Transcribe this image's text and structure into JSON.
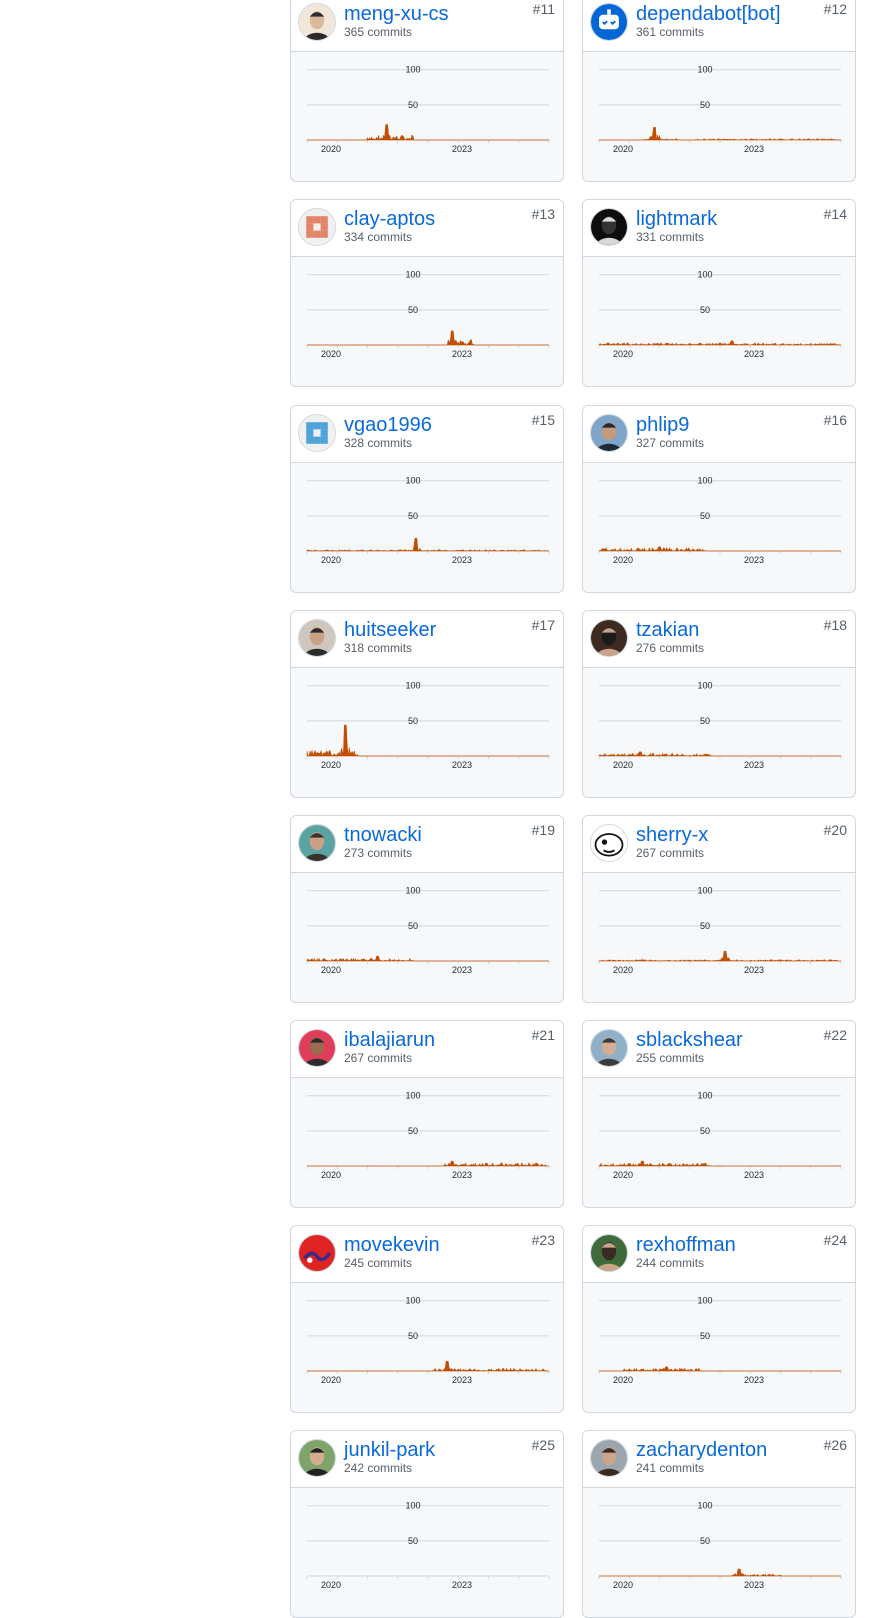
{
  "contributors": [
    {
      "rank": "#11",
      "login": "meng-xu-cs",
      "commits": "365 commits",
      "avatar_icon": "person-photo-avatar",
      "avatar_colors": [
        "#f2e6da",
        "#2b2b2b",
        "#d9b99a"
      ],
      "activity": {
        "ranges": [
          [
            0.25,
            0.44
          ]
        ],
        "peaks": [
          [
            0.33,
            22
          ]
        ],
        "level": 7
      }
    },
    {
      "rank": "#12",
      "login": "dependabot[bot]",
      "commits": "361 commits",
      "avatar_icon": "robot-avatar",
      "avatar_colors": [
        "#0366d6",
        "#ffffff",
        "#0366d6"
      ],
      "activity": {
        "ranges": [
          [
            0.18,
            0.33
          ],
          [
            0.4,
            0.99
          ]
        ],
        "peaks": [
          [
            0.23,
            18
          ]
        ],
        "level": 2
      }
    },
    {
      "rank": "#13",
      "login": "clay-aptos",
      "commits": "334 commits",
      "avatar_icon": "identicon-avatar",
      "avatar_colors": [
        "#f0f0f0",
        "#e2856b",
        "#ffffff"
      ],
      "activity": {
        "ranges": [
          [
            0.59,
            0.69
          ]
        ],
        "peaks": [
          [
            0.6,
            20
          ]
        ],
        "level": 8
      }
    },
    {
      "rank": "#14",
      "login": "lightmark",
      "commits": "331 commits",
      "avatar_icon": "person-photo-avatar",
      "avatar_colors": [
        "#0d0d0d",
        "#d8d8d8",
        "#333333"
      ],
      "activity": {
        "ranges": [
          [
            0.0,
            0.99
          ]
        ],
        "peaks": [
          [
            0.55,
            6
          ]
        ],
        "level": 3
      }
    },
    {
      "rank": "#15",
      "login": "vgao1996",
      "commits": "328 commits",
      "avatar_icon": "identicon-avatar",
      "avatar_colors": [
        "#f0f0f0",
        "#4fa3d9",
        "#ffffff"
      ],
      "activity": {
        "ranges": [
          [
            0.0,
            0.99
          ]
        ],
        "peaks": [
          [
            0.45,
            18
          ]
        ],
        "level": 2
      }
    },
    {
      "rank": "#16",
      "login": "phlip9",
      "commits": "327 commits",
      "avatar_icon": "person-photo-avatar",
      "avatar_colors": [
        "#7fa6c8",
        "#1e2a36",
        "#c49a7a"
      ],
      "activity": {
        "ranges": [
          [
            0.0,
            0.44
          ]
        ],
        "peaks": [
          [
            0.25,
            6
          ]
        ],
        "level": 5
      }
    },
    {
      "rank": "#17",
      "login": "huitseeker",
      "commits": "318 commits",
      "avatar_icon": "person-photo-avatar",
      "avatar_colors": [
        "#cfc7bd",
        "#2a2a2a",
        "#c7a184"
      ],
      "activity": {
        "ranges": [
          [
            0.0,
            0.22
          ]
        ],
        "peaks": [
          [
            0.16,
            44
          ]
        ],
        "level": 8
      }
    },
    {
      "rank": "#18",
      "login": "tzakian",
      "commits": "276 commits",
      "avatar_icon": "person-photo-avatar",
      "avatar_colors": [
        "#3d2b22",
        "#caa38a",
        "#1a1a1a"
      ],
      "activity": {
        "ranges": [
          [
            0.0,
            0.46
          ]
        ],
        "peaks": [
          [
            0.17,
            6
          ]
        ],
        "level": 4
      }
    },
    {
      "rank": "#19",
      "login": "tnowacki",
      "commits": "273 commits",
      "avatar_icon": "person-photo-avatar",
      "avatar_colors": [
        "#5aa3a0",
        "#3a3128",
        "#caa186"
      ],
      "activity": {
        "ranges": [
          [
            0.0,
            0.44
          ]
        ],
        "peaks": [
          [
            0.29,
            7
          ]
        ],
        "level": 4
      }
    },
    {
      "rank": "#20",
      "login": "sherry-x",
      "commits": "267 commits",
      "avatar_icon": "cartoon-avatar",
      "avatar_colors": [
        "#ffffff",
        "#111111",
        "#f2c14e"
      ],
      "activity": {
        "ranges": [
          [
            0.0,
            0.99
          ]
        ],
        "peaks": [
          [
            0.52,
            14
          ]
        ],
        "level": 2
      }
    },
    {
      "rank": "#21",
      "login": "ibalajiarun",
      "commits": "267 commits",
      "avatar_icon": "person-photo-avatar",
      "avatar_colors": [
        "#e03d5b",
        "#2c2c2c",
        "#9c6a4e"
      ],
      "activity": {
        "ranges": [
          [
            0.57,
            0.99
          ]
        ],
        "peaks": [
          [
            0.6,
            7
          ]
        ],
        "level": 5
      }
    },
    {
      "rank": "#22",
      "login": "sblackshear",
      "commits": "255 commits",
      "avatar_icon": "person-photo-avatar",
      "avatar_colors": [
        "#8fb0c8",
        "#3b3b3b",
        "#d2ae94"
      ],
      "activity": {
        "ranges": [
          [
            0.0,
            0.46
          ]
        ],
        "peaks": [
          [
            0.18,
            7
          ]
        ],
        "level": 4
      }
    },
    {
      "rank": "#23",
      "login": "movekevin",
      "commits": "245 commits",
      "avatar_icon": "pattern-avatar",
      "avatar_colors": [
        "#e02424",
        "#3b2a8a",
        "#ffffff"
      ],
      "activity": {
        "ranges": [
          [
            0.52,
            0.99
          ]
        ],
        "peaks": [
          [
            0.58,
            14
          ]
        ],
        "level": 4
      }
    },
    {
      "rank": "#24",
      "login": "rexhoffman",
      "commits": "244 commits",
      "avatar_icon": "person-photo-avatar",
      "avatar_colors": [
        "#3f6b3a",
        "#caa689",
        "#3a2c24"
      ],
      "activity": {
        "ranges": [
          [
            0.1,
            0.42
          ]
        ],
        "peaks": [
          [
            0.28,
            6
          ]
        ],
        "level": 4
      }
    },
    {
      "rank": "#25",
      "login": "junkil-park",
      "commits": "242 commits",
      "avatar_icon": "person-photo-avatar",
      "avatar_colors": [
        "#7ea46a",
        "#222222",
        "#d3ad8f"
      ],
      "activity": {
        "ranges": [],
        "peaks": [],
        "level": 0
      }
    },
    {
      "rank": "#26",
      "login": "zacharydenton",
      "commits": "241 commits",
      "avatar_icon": "person-photo-avatar",
      "avatar_colors": [
        "#9aa5ad",
        "#3a2b22",
        "#caa68c"
      ],
      "activity": {
        "ranges": [
          [
            0.55,
            0.75
          ]
        ],
        "peaks": [
          [
            0.58,
            10
          ]
        ],
        "level": 3
      }
    }
  ],
  "axis": {
    "y_ticks": [
      "100",
      "50"
    ],
    "y_values": [
      100,
      50
    ],
    "x_ticks": [
      "2020",
      "2023"
    ],
    "ymax": 120
  },
  "colors": {
    "area": "#c24e00",
    "grid": "#d0d7de",
    "link": "#0969da"
  }
}
